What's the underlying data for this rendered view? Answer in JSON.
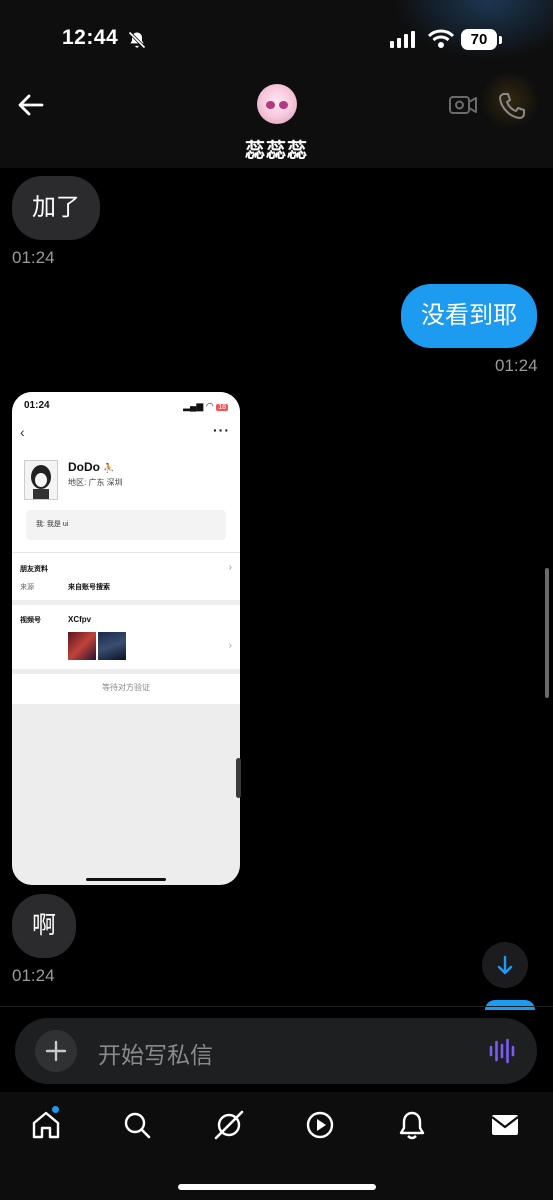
{
  "status_bar": {
    "time": "12:44",
    "battery": "70"
  },
  "header": {
    "contact_name": "蕊蕊蕊"
  },
  "messages": [
    {
      "side": "in",
      "text": "加了",
      "time": "01:24"
    },
    {
      "side": "out",
      "text": "没看到耶",
      "time": "01:24"
    },
    {
      "side": "in",
      "text": "啊",
      "time": "01:24"
    }
  ],
  "shared_screenshot": {
    "time": "01:24",
    "battery": "18",
    "name": "DoDo",
    "region": "地区: 广东 深圳",
    "greeting": "我: 我是 ui",
    "friend_info_label": "朋友资料",
    "source_label": "来源",
    "source_value": "来自账号搜索",
    "channel_label": "视频号",
    "channel_value": "XCfpv",
    "pending": "等待对方验证"
  },
  "composer": {
    "placeholder": "开始写私信"
  },
  "tabs": [
    "home",
    "search",
    "grok",
    "video",
    "notifications",
    "messages"
  ],
  "colors": {
    "accent": "#1d9bf0",
    "bubble_in": "#2b2b2d",
    "voice": "#7b5cf5"
  }
}
